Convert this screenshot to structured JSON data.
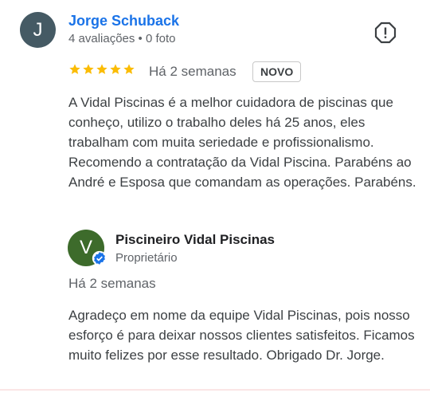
{
  "review": {
    "avatar_letter": "J",
    "reviewer_name": "Jorge Schuback",
    "reviewer_meta": "4 avaliações • 0 foto",
    "rating": 5,
    "rating_max": 5,
    "date": "Há 2 semanas",
    "badge": "NOVO",
    "text": "A Vidal Piscinas é a melhor cuidadora de piscinas que conheço, utilizo o trabalho deles há 25 anos, eles trabalham com muita seriedade e profissionalismo. Recomendo a contratação da Vidal Piscina. Parabéns ao André e Esposa que comandam as operações. Parabéns."
  },
  "owner_reply": {
    "avatar_letter": "V",
    "name": "Piscineiro Vidal Piscinas",
    "role": "Proprietário",
    "date": "Há 2 semanas",
    "text": "Agradeço em nome da equipe Vidal Piscinas, pois nosso esforço é para deixar nossos clientes satisfeitos. Ficamos muito felizes por esse resultado. Obrigado Dr. Jorge."
  },
  "icons": {
    "report": "report-icon",
    "star": "star-icon",
    "verified": "verified-badge-icon"
  },
  "colors": {
    "name_link": "#1a73e8",
    "star": "#fbbc04",
    "user_avatar": "#455a64",
    "owner_avatar": "#3d6b2b",
    "verified": "#1a73e8"
  }
}
